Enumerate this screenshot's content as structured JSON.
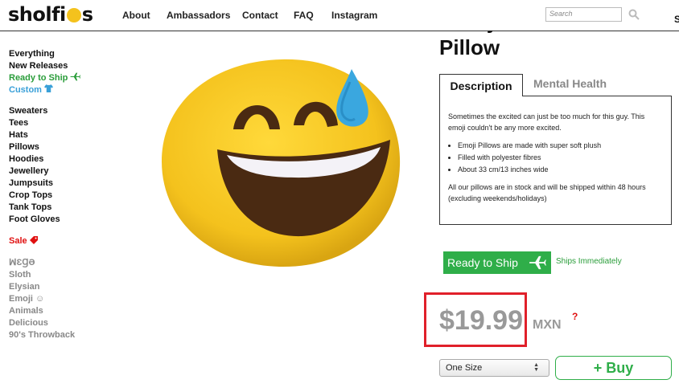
{
  "header": {
    "logo": "shᴏlfi",
    "logo_tail": "s",
    "nav": [
      "About",
      "Ambassadors",
      "Contact",
      "FAQ",
      "Instagram"
    ],
    "search_placeholder": "Search",
    "cut_letter": "S"
  },
  "sidebar": {
    "group1": [
      "Everything",
      "New Releases",
      "Ready to Ship",
      "Custom"
    ],
    "group2": [
      "Sweaters",
      "Tees",
      "Hats",
      "Pillows",
      "Hoodies",
      "Jewellery",
      "Jumpsuits",
      "Crop Tops",
      "Tank Tops",
      "Foot Gloves"
    ],
    "sale": "Sale",
    "group3": [
      "ꟽƐꞬƏ",
      "Sloth",
      "Elysian",
      "Emoji ☺",
      "Animals",
      "Delicious",
      "90's Throwback"
    ]
  },
  "product": {
    "title": "Pillow",
    "tabs": [
      "Description",
      "Mental Health"
    ],
    "description": {
      "intro": "Sometimes the excited can just be too much for this guy. This emoji couldn't be any more excited.",
      "bullets": [
        "Emoji Pillows are made with super soft plush",
        "Filled with polyester fibres",
        "About 33 cm/13 inches wide"
      ],
      "footer": "All our pillows are in stock and will be shipped within 48 hours (excluding weekends/holidays)"
    },
    "ready_to_ship": "Ready to Ship",
    "ships_text": "Ships Immediately",
    "price": "$19.99",
    "currency": "MXN",
    "help": "?",
    "size": "One Size",
    "buy": "+ Buy"
  },
  "colors": {
    "accent_green": "#2fae49",
    "sale_red": "#e01010",
    "price_highlight": "#e0202a",
    "emoji_yellow": "#f4c21d",
    "sweat_blue": "#3aa7df"
  }
}
